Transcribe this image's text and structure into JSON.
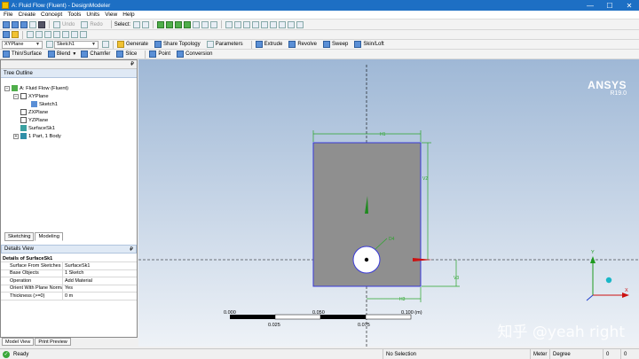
{
  "window": {
    "title": "A: Fluid Flow (Fluent) - DesignModeler",
    "minimize": "—",
    "restore": "☐",
    "close": "✕"
  },
  "menu": [
    "File",
    "Create",
    "Concept",
    "Tools",
    "Units",
    "View",
    "Help"
  ],
  "toolbar1": {
    "undo": "Undo",
    "redo": "Redo",
    "select": "Select:"
  },
  "toolbar3": {
    "plane": "XYPlane",
    "sketch": "Sketch1",
    "generate": "Generate",
    "share_topology": "Share Topology",
    "parameters": "Parameters",
    "extrude": "Extrude",
    "revolve": "Revolve",
    "sweep": "Sweep",
    "skin_loft": "Skin/Loft"
  },
  "toolbar4": {
    "thin_surface": "Thin/Surface",
    "blend": "Blend",
    "chamfer": "Chamfer",
    "slice": "Slice",
    "point": "Point",
    "conversion": "Conversion"
  },
  "tree_outline": {
    "header": "Tree Outline",
    "items": [
      {
        "label": "A: Fluid Flow (Fluent)",
        "depth": 0,
        "expander": "−"
      },
      {
        "label": "XYPlane",
        "depth": 1,
        "expander": "−"
      },
      {
        "label": "Sketch1",
        "depth": 2,
        "expander": ""
      },
      {
        "label": "ZXPlane",
        "depth": 1,
        "expander": ""
      },
      {
        "label": "YZPlane",
        "depth": 1,
        "expander": ""
      },
      {
        "label": "SurfaceSk1",
        "depth": 1,
        "expander": ""
      },
      {
        "label": "1 Part, 1 Body",
        "depth": 1,
        "expander": "+"
      }
    ]
  },
  "tabs": [
    "Sketching",
    "Modeling"
  ],
  "details": {
    "header": "Details View",
    "pin": "₽",
    "group": "Details of SurfaceSk1",
    "rows": [
      {
        "k": "Surface From Sketches",
        "v": "SurfaceSk1"
      },
      {
        "k": "Base Objects",
        "v": "1 Sketch"
      },
      {
        "k": "Operation",
        "v": "Add Material"
      },
      {
        "k": "Orient With Plane Normal?",
        "v": "Yes"
      },
      {
        "k": "Thickness (>=0)",
        "v": "0 m"
      }
    ]
  },
  "bottom_tabs": [
    "Model View",
    "Print Preview"
  ],
  "status": {
    "ready": "Ready",
    "selection": "No Selection",
    "unit": "Meter",
    "angle": "Degree",
    "v1": "0",
    "v2": "0"
  },
  "viewport": {
    "brand": "ANSYS",
    "version": "R19.0",
    "watermark": "知乎 @yeah right",
    "dims": {
      "h1": "H1",
      "h3": "H3",
      "v2": "V2",
      "v3": "V3",
      "d4": "D4"
    },
    "scale": {
      "t0": "0.000",
      "t1": "0.050",
      "t2": "0.100 (m)",
      "b1": "0.025",
      "b2": "0.075"
    },
    "axes": {
      "y": "Y",
      "x": "X"
    },
    "colors": {
      "bg_top": "#9fb8d6",
      "bg_bottom": "#eef2f7",
      "body": "#8f8f8f",
      "sketch": "#3a3ad8",
      "dimension": "#2aa52a"
    }
  }
}
